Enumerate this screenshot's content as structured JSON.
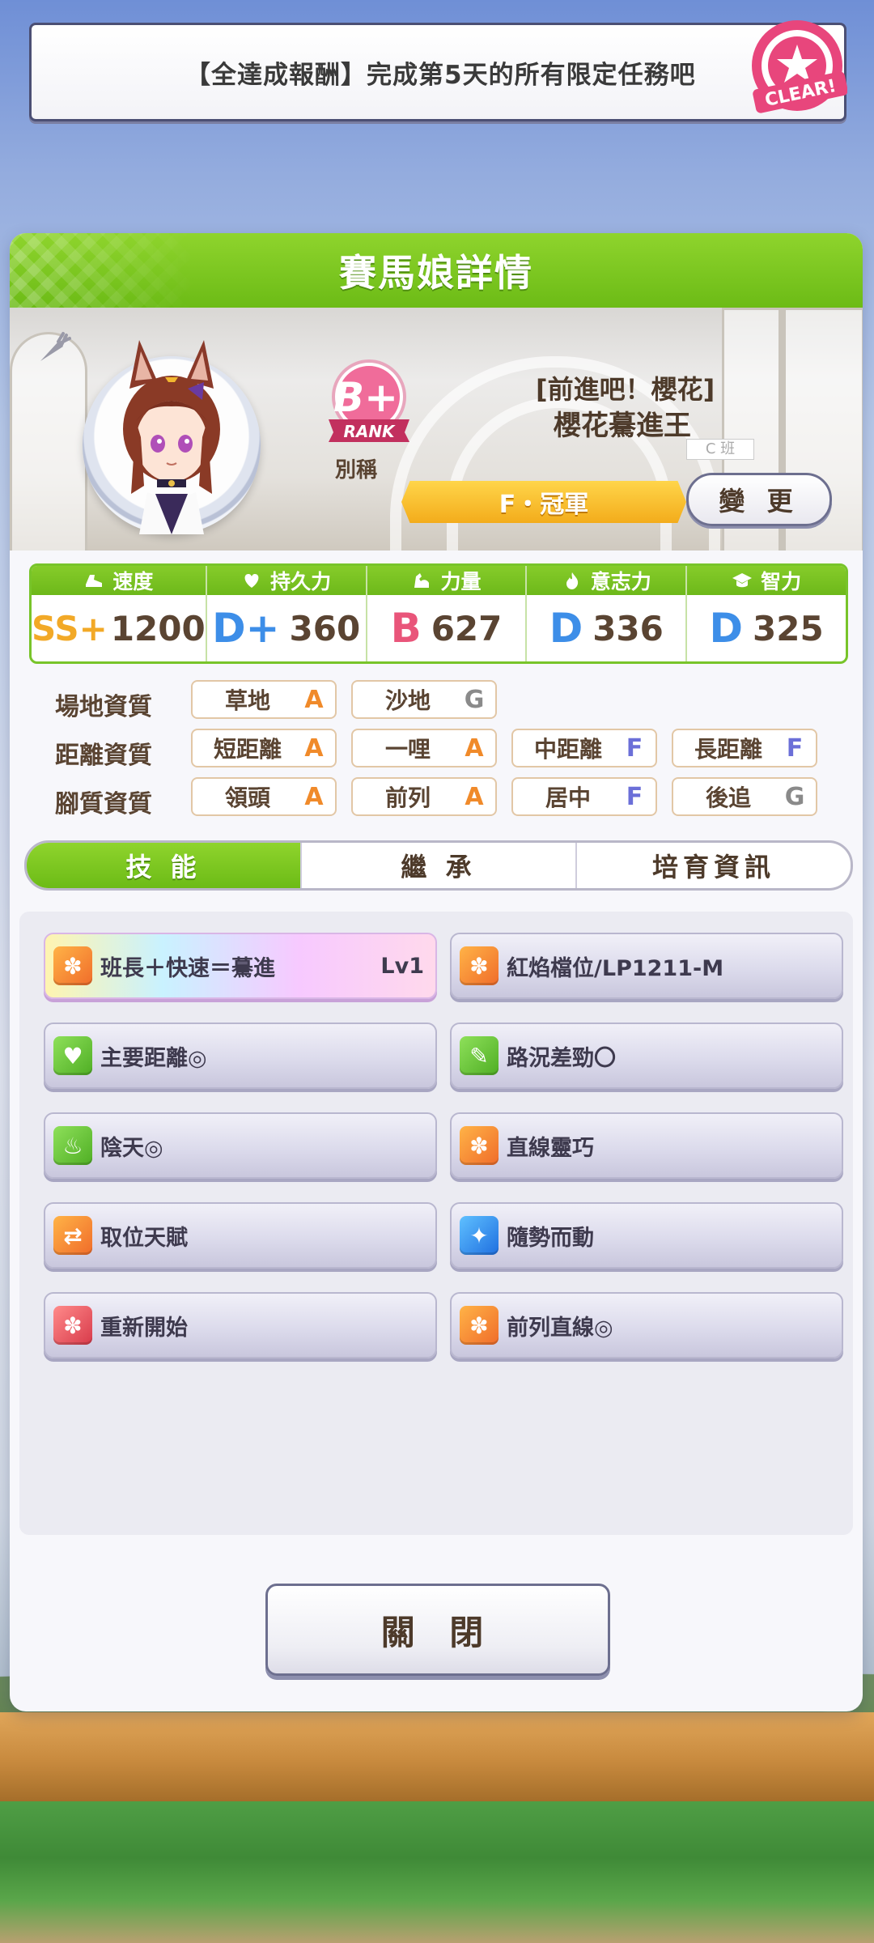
{
  "banner": {
    "text": "【全達成報酬】完成第5天的所有限定任務吧",
    "stamp_text": "CLEAR!"
  },
  "panel": {
    "title": "賽馬娘詳情"
  },
  "character": {
    "rank_grade": "B+",
    "rank_label": "RANK",
    "nickname_label": "別稱",
    "title_line1": "[前進吧！櫻花]",
    "title_line2": "櫻花驀進王",
    "class_sign": "C 班",
    "ribbon_text": "F・冠軍",
    "change_button": "變 更"
  },
  "stats": [
    {
      "label": "速度",
      "icon": "shoe-icon",
      "grade": "SS+",
      "value": "1200"
    },
    {
      "label": "持久力",
      "icon": "heart-icon",
      "grade": "D+",
      "value": "360"
    },
    {
      "label": "力量",
      "icon": "muscle-icon",
      "grade": "B",
      "value": "627"
    },
    {
      "label": "意志力",
      "icon": "flame-icon",
      "grade": "D",
      "value": "336"
    },
    {
      "label": "智力",
      "icon": "graduation-cap-icon",
      "grade": "D",
      "value": "325"
    }
  ],
  "aptitude": {
    "track": {
      "label": "場地資質",
      "items": [
        {
          "name": "草地",
          "grade": "A"
        },
        {
          "name": "沙地",
          "grade": "G"
        }
      ]
    },
    "distance": {
      "label": "距離資質",
      "items": [
        {
          "name": "短距離",
          "grade": "A"
        },
        {
          "name": "一哩",
          "grade": "A"
        },
        {
          "name": "中距離",
          "grade": "F"
        },
        {
          "name": "長距離",
          "grade": "F"
        }
      ]
    },
    "style": {
      "label": "腳質資質",
      "items": [
        {
          "name": "領頭",
          "grade": "A"
        },
        {
          "name": "前列",
          "grade": "A"
        },
        {
          "name": "居中",
          "grade": "F"
        },
        {
          "name": "後追",
          "grade": "G"
        }
      ]
    }
  },
  "tabs": [
    {
      "label": "技 能"
    },
    {
      "label": "繼 承"
    },
    {
      "label": "培育資訊"
    }
  ],
  "skills": [
    {
      "name": "班長＋快速＝驀進",
      "level": "Lv1",
      "icon": "rainbow-runner-icon",
      "color": "#f39a2b"
    },
    {
      "name": "紅焰檔位/LP1211-M",
      "level": "",
      "icon": "runner-icon",
      "color": "#f39a2b"
    },
    {
      "name": "主要距離◎",
      "level": "",
      "icon": "heart-icon",
      "color": "#6bc232"
    },
    {
      "name": "路況差勁〇",
      "level": "",
      "icon": "muscle-icon",
      "color": "#6bc232"
    },
    {
      "name": "陰天◎",
      "level": "",
      "icon": "flame-icon",
      "color": "#6bc232"
    },
    {
      "name": "直線靈巧",
      "level": "",
      "icon": "runner-icon",
      "color": "#f39a2b"
    },
    {
      "name": "取位天賦",
      "level": "",
      "icon": "swap-arrows-icon",
      "color": "#f39a2b"
    },
    {
      "name": "隨勢而動",
      "level": "",
      "icon": "sparkle-icon",
      "color": "#2f8ff0"
    },
    {
      "name": "重新開始",
      "level": "",
      "icon": "runner-red-icon",
      "color": "#e8505b"
    },
    {
      "name": "前列直線◎",
      "level": "",
      "icon": "runner-icon",
      "color": "#f39a2b"
    }
  ],
  "close_button": "關 閉",
  "grade_colors": {
    "S": "#f2a927",
    "A": "#f08a2a",
    "B": "#e9557a",
    "D": "#3d8ee8",
    "F": "#6b6fd8",
    "G": "#8a8a8a"
  }
}
